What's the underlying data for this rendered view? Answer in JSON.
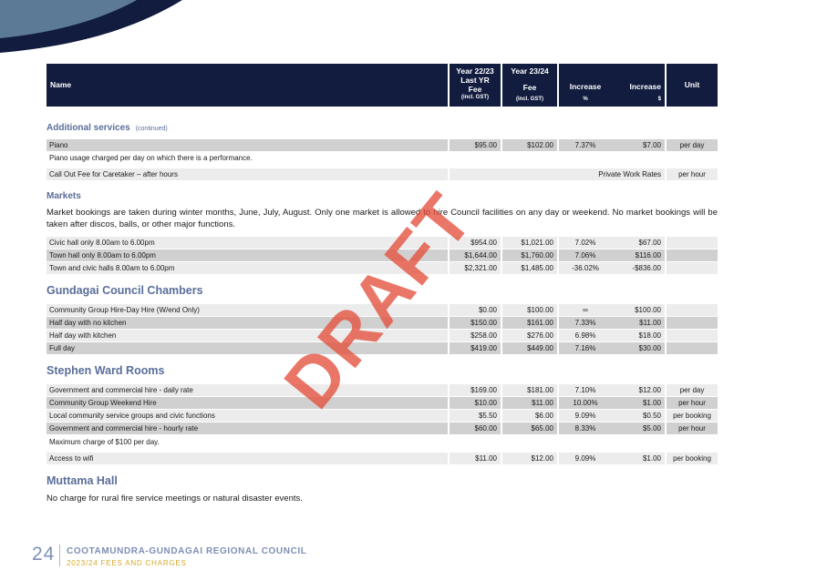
{
  "header": {
    "name": "Name",
    "year1_line1": "Year 22/23",
    "year1_line2": "Last YR",
    "year1_line3": "Fee",
    "year1_sub": "(incl. GST)",
    "year2_line1": "Year 23/24",
    "year2_line2": "Fee",
    "year2_sub": "(incl. GST)",
    "increase_pct": "Increase",
    "increase_dol": "Increase",
    "increase_pct_sub": "%",
    "increase_dol_sub": "$",
    "unit": "Unit"
  },
  "additional": {
    "title": "Additional services",
    "continued": "(continued)",
    "piano": {
      "name": "Piano",
      "y1": "$95.00",
      "y2": "$102.00",
      "pct": "7.37%",
      "dol": "$7.00",
      "unit": "per day"
    },
    "piano_note": "Piano usage charged per day on which there is a performance.",
    "callout": {
      "name": "Call Out Fee for Caretaker – after hours",
      "span": "Private Work Rates",
      "unit": "per hour"
    }
  },
  "markets": {
    "title": "Markets",
    "paragraph": "Market bookings are taken during winter months, June, July, August. Only one market is allowed to hire Council facilities on any day or weekend. No market bookings will be taken after discos, balls, or other major functions.",
    "rows": [
      {
        "name": "Civic hall only 8.00am to 6.00pm",
        "y1": "$954.00",
        "y2": "$1,021.00",
        "pct": "7.02%",
        "dol": "$67.00",
        "unit": ""
      },
      {
        "name": "Town hall only 8.00am to 6.00pm",
        "y1": "$1,644.00",
        "y2": "$1,760.00",
        "pct": "7.06%",
        "dol": "$116.00",
        "unit": ""
      },
      {
        "name": "Town and civic halls 8.00am to 6.00pm",
        "y1": "$2,321.00",
        "y2": "$1,485.00",
        "pct": "-36.02%",
        "dol": "-$836.00",
        "unit": ""
      }
    ]
  },
  "gundagai": {
    "title": "Gundagai Council Chambers",
    "rows": [
      {
        "name": "Community Group Hire-Day Hire (W/end Only)",
        "y1": "$0.00",
        "y2": "$100.00",
        "pct": "∞",
        "dol": "$100.00",
        "unit": ""
      },
      {
        "name": "Half day with no kitchen",
        "y1": "$150.00",
        "y2": "$161.00",
        "pct": "7.33%",
        "dol": "$11.00",
        "unit": ""
      },
      {
        "name": "Half day with kitchen",
        "y1": "$258.00",
        "y2": "$276.00",
        "pct": "6.98%",
        "dol": "$18.00",
        "unit": ""
      },
      {
        "name": "Full day",
        "y1": "$419.00",
        "y2": "$449.00",
        "pct": "7.16%",
        "dol": "$30.00",
        "unit": ""
      }
    ]
  },
  "stephen": {
    "title": "Stephen Ward Rooms",
    "rows": [
      {
        "name": "Government and commercial hire - daily rate",
        "y1": "$169.00",
        "y2": "$181.00",
        "pct": "7.10%",
        "dol": "$12.00",
        "unit": "per day"
      },
      {
        "name": "Community Group Weekend Hire",
        "y1": "$10.00",
        "y2": "$11.00",
        "pct": "10.00%",
        "dol": "$1.00",
        "unit": "per hour"
      },
      {
        "name": "Local community service groups and civic functions",
        "y1": "$5.50",
        "y2": "$6.00",
        "pct": "9.09%",
        "dol": "$0.50",
        "unit": "per booking"
      },
      {
        "name": "Government and commercial hire - hourly rate",
        "y1": "$60.00",
        "y2": "$65.00",
        "pct": "8.33%",
        "dol": "$5.00",
        "unit": "per hour"
      }
    ],
    "note": "Maximum charge of $100 per day.",
    "wifi": {
      "name": "Access to wifi",
      "y1": "$11.00",
      "y2": "$12.00",
      "pct": "9.09%",
      "dol": "$1.00",
      "unit": "per booking"
    }
  },
  "muttama": {
    "title": "Muttama Hall",
    "paragraph": "No charge for rural fire service meetings or natural disaster events."
  },
  "watermark": "DRAFT",
  "footer": {
    "page_number": "24",
    "organisation": "COOTAMUNDRA-GUNDAGAI REGIONAL COUNCIL",
    "subtitle": "2023/24 FEES AND CHARGES"
  }
}
